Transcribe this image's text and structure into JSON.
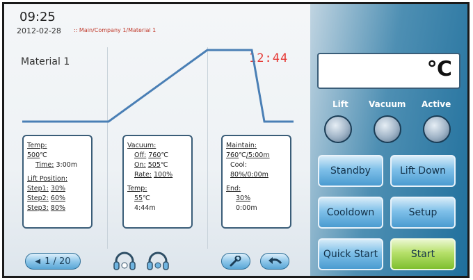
{
  "header": {
    "time": "09:25",
    "date": "2012-02-28",
    "breadcrumb": ":: Main/Company 1/Material 1"
  },
  "material": {
    "name": "Material 1",
    "timer": "12:44"
  },
  "cards": {
    "card1": {
      "temp_label": "Temp:",
      "temp_value": "500",
      "temp_unit": "℃",
      "time_label": "Time:",
      "time_value": "3:00m",
      "lift_label": "Lift Position:",
      "step1_label": "Step1:",
      "step1_value": "30%",
      "step2_label": "Step2:",
      "step2_value": "60%",
      "step3_label": "Step3:",
      "step3_value": "80%"
    },
    "card2": {
      "vacuum_label": "Vacuum:",
      "off_label": "Off:",
      "off_value": "760",
      "off_unit": "℃",
      "on_label": "On:",
      "on_value": "505",
      "on_unit": "℃",
      "rate_label": "Rate:",
      "rate_value": "100%",
      "temp_label": "Temp:",
      "temp_value": "55",
      "temp_unit": "℃",
      "time_value": "4:44m"
    },
    "card3": {
      "maintain_label": "Maintain:",
      "maintain_value": "760",
      "maintain_unit": "℃",
      "maintain_time": "/5:00m",
      "cool_label": "Cool:",
      "cool_value": "80%/0:00m",
      "end_label": "End:",
      "end_value": "30%",
      "end_time": "0:00m"
    }
  },
  "nav": {
    "page_indicator": "1 / 20"
  },
  "display": {
    "unit": "℃"
  },
  "indicators": [
    {
      "label": "Lift"
    },
    {
      "label": "Vacuum"
    },
    {
      "label": "Active"
    }
  ],
  "buttons": {
    "standby": "Standby",
    "lift_down": "Lift Down",
    "cooldown": "Cooldown",
    "setup": "Setup",
    "quick_start": "Quick Start",
    "start": "Start"
  },
  "colors": {
    "accent": "#4a9bd0",
    "start_green": "#7fbf2f",
    "timer_red": "#e53935",
    "profile_line": "#4a7fb5"
  },
  "icons": {
    "wrench": "wrench-icon",
    "back": "back-arrow-icon",
    "headphone_left": "headphone-icon",
    "headphone_right": "headphone-icon"
  }
}
